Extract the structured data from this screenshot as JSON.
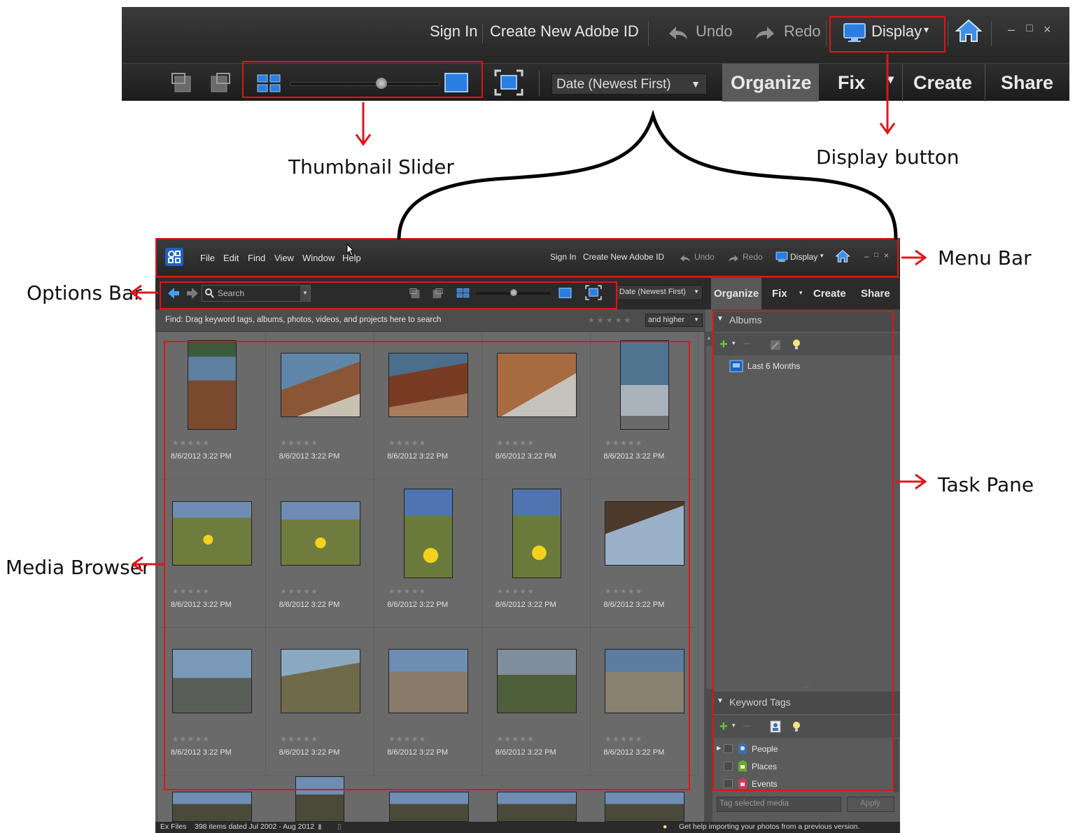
{
  "toolbar_zoom": {
    "sign_in": "Sign In",
    "create_id": "Create New Adobe ID",
    "undo": "Undo",
    "redo": "Redo",
    "display": "Display",
    "sort": "Date (Newest First)",
    "tabs": [
      "Organize",
      "Fix",
      "Create",
      "Share"
    ]
  },
  "annotations": {
    "thumbnail_slider": "Thumbnail Slider",
    "display_button": "Display button",
    "menu_bar": "Menu Bar",
    "options_bar": "Options Bar",
    "task_pane": "Task Pane",
    "media_browser": "Media Browser"
  },
  "app": {
    "menu": [
      "File",
      "Edit",
      "Find",
      "View",
      "Window",
      "Help"
    ],
    "sign_in": "Sign In",
    "create_id": "Create New Adobe ID",
    "undo": "Undo",
    "redo": "Redo",
    "display": "Display",
    "search_placeholder": "Search",
    "sort": "Date (Newest First)",
    "tabs": [
      "Organize",
      "Fix",
      "Create",
      "Share"
    ],
    "find_hint": "Find: Drag keyword tags, albums, photos, videos, and projects here to search",
    "rating_filter": "and higher",
    "photo_date": "8/6/2012 3:22 PM",
    "albums": {
      "header": "Albums",
      "items": [
        "Last 6 Months"
      ]
    },
    "keyword_tags": {
      "header": "Keyword Tags",
      "items": [
        "People",
        "Places",
        "Events"
      ]
    },
    "tag_input_placeholder": "Tag selected media",
    "apply": "Apply",
    "status": {
      "catalog": "Ex Files",
      "count": "398 items dated Jul 2002 - Aug 2012",
      "tip": "Get help importing your photos from a previous version."
    }
  },
  "colors": {
    "annotation_red": "#e1141a",
    "ui_dark": "#2b2b2b",
    "brand_blue": "#2a7de1"
  }
}
